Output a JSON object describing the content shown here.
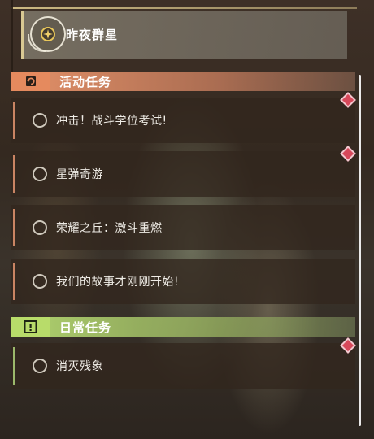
{
  "tracked_quest": {
    "title": "昨夜群星",
    "icon": "star-compass-icon"
  },
  "sections": [
    {
      "id": "event",
      "title": "活动任务",
      "icon": "event-refresh-icon",
      "color": "#e58a5e",
      "quests": [
        {
          "label": "冲击！战斗学位考试!",
          "new": true
        },
        {
          "label": "星弹奇游",
          "new": true
        },
        {
          "label": "荣耀之丘：激斗重燃",
          "new": false
        },
        {
          "label": "我们的故事才刚刚开始!",
          "new": false
        }
      ]
    },
    {
      "id": "daily",
      "title": "日常任务",
      "icon": "exclamation-box-icon",
      "color": "#b8dc6a",
      "quests": [
        {
          "label": "消灭残象",
          "new": true
        }
      ]
    }
  ]
}
